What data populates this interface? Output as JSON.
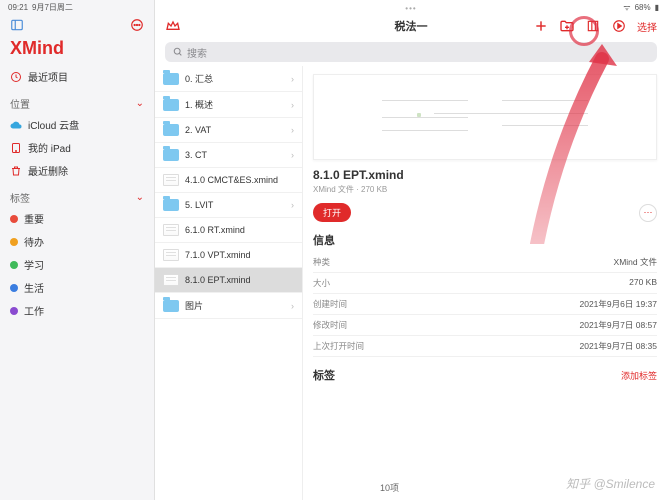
{
  "status": {
    "time": "09:21",
    "date": "9月7日周二",
    "battery": "68%"
  },
  "sidebar": {
    "app_name": "XMind",
    "recent": "最近项目",
    "loc_header": "位置",
    "locations": [
      {
        "label": "iCloud 云盘",
        "icon": "cloud",
        "color": "#36a6de"
      },
      {
        "label": "我的 iPad",
        "icon": "ipad",
        "color": "#e02a2a"
      },
      {
        "label": "最近删除",
        "icon": "trash",
        "color": "#e02a2a"
      }
    ],
    "tag_header": "标签",
    "tags": [
      {
        "label": "重要",
        "color": "#e84b3c"
      },
      {
        "label": "待办",
        "color": "#f0a020"
      },
      {
        "label": "学习",
        "color": "#3fba5a"
      },
      {
        "label": "生活",
        "color": "#3a7de0"
      },
      {
        "label": "工作",
        "color": "#8a4bd0"
      }
    ]
  },
  "toolbar": {
    "title": "税法一",
    "select": "选择"
  },
  "search": {
    "placeholder": "搜索"
  },
  "files": [
    {
      "name": "0. 汇总",
      "type": "folder"
    },
    {
      "name": "1. 概述",
      "type": "folder"
    },
    {
      "name": "2. VAT",
      "type": "folder"
    },
    {
      "name": "3. CT",
      "type": "folder"
    },
    {
      "name": "4.1.0 CMCT&ES.xmind",
      "type": "file"
    },
    {
      "name": "5. LVIT",
      "type": "folder"
    },
    {
      "name": "6.1.0 RT.xmind",
      "type": "file"
    },
    {
      "name": "7.1.0 VPT.xmind",
      "type": "file"
    },
    {
      "name": "8.1.0 EPT.xmind",
      "type": "file",
      "selected": true
    },
    {
      "name": "图片",
      "type": "folder"
    }
  ],
  "detail": {
    "name": "8.1.0 EPT.xmind",
    "subtitle": "XMind 文件 · 270 KB",
    "open": "打开",
    "info_header": "信息",
    "info": [
      {
        "k": "种类",
        "v": "XMind 文件"
      },
      {
        "k": "大小",
        "v": "270 KB"
      },
      {
        "k": "创建时间",
        "v": "2021年9月6日 19:37"
      },
      {
        "k": "修改时间",
        "v": "2021年9月7日 08:57"
      },
      {
        "k": "上次打开时间",
        "v": "2021年9月7日 08:35"
      }
    ],
    "tag_header": "标签",
    "add_tag": "添加标签"
  },
  "footer": {
    "count": "10项"
  },
  "watermark": "知乎 @Smilence"
}
